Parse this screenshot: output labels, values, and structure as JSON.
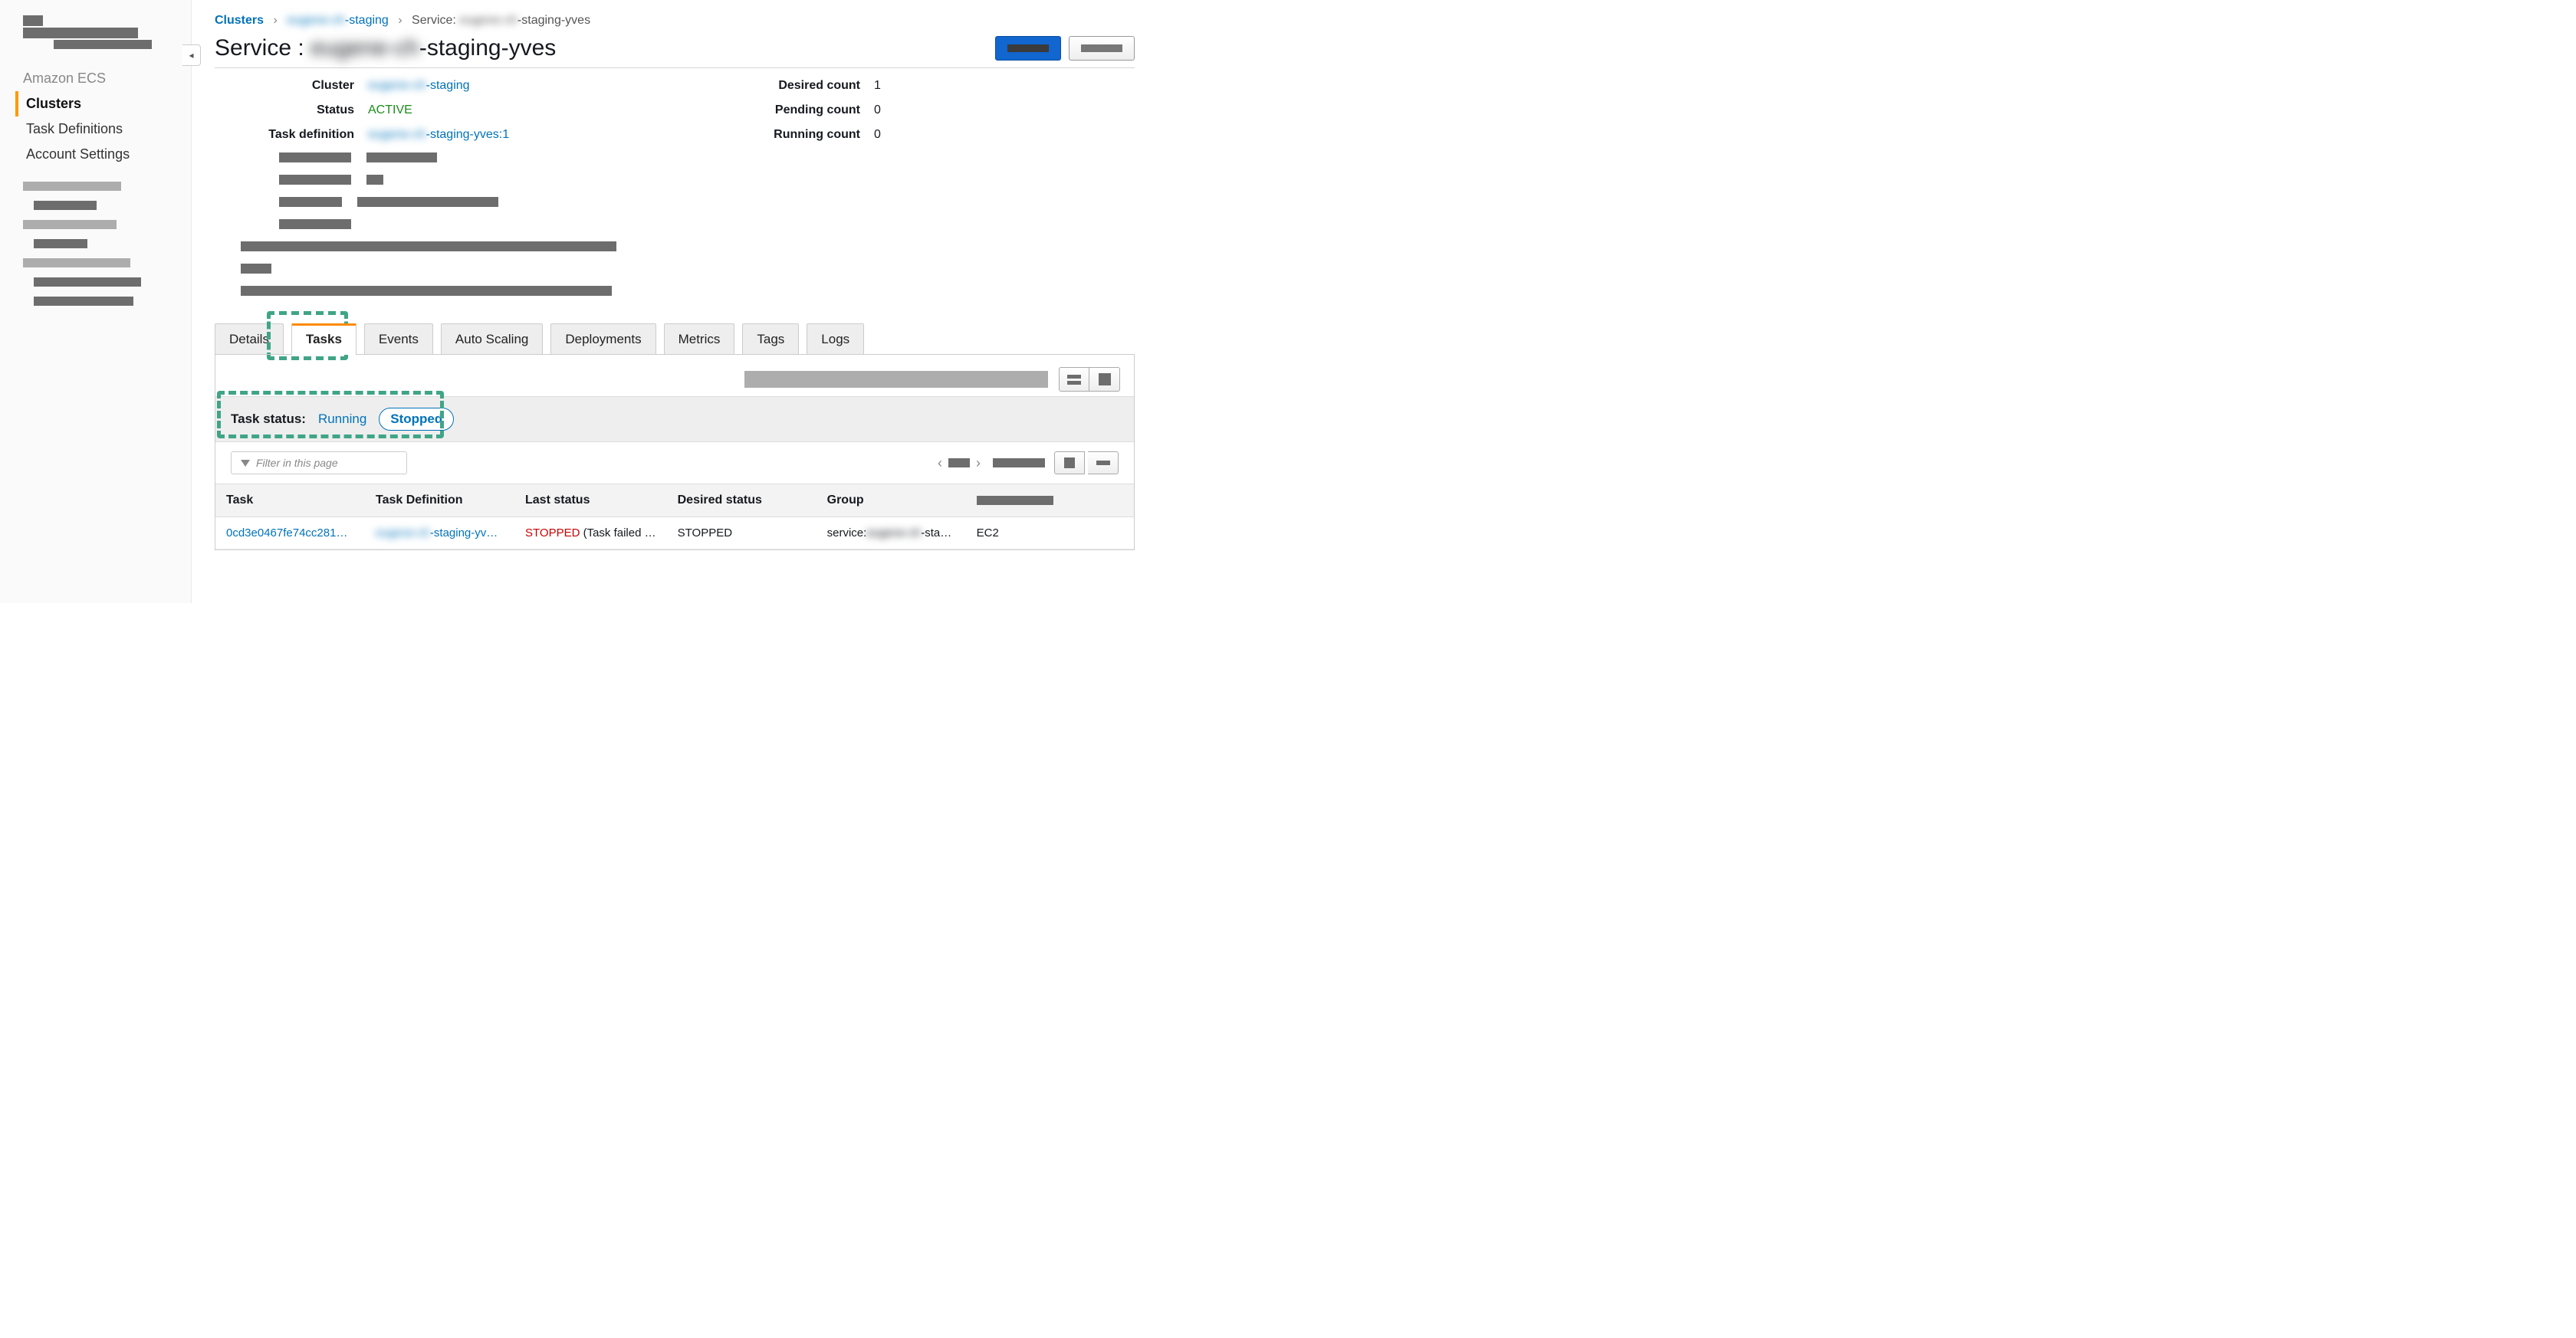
{
  "sidebar": {
    "service_title": "Amazon ECS",
    "nav": {
      "clusters": "Clusters",
      "task_definitions": "Task Definitions",
      "account_settings": "Account Settings"
    }
  },
  "breadcrumb": {
    "root": "Clusters",
    "cluster_redacted": "eugene-ch",
    "cluster_suffix": "-staging",
    "service_prefix": "Service: ",
    "service_redacted": "eugene-ch",
    "service_suffix": "-staging-yves"
  },
  "title": {
    "prefix": "Service : ",
    "redacted": "eugene-ch",
    "suffix": "-staging-yves"
  },
  "details": {
    "labels": {
      "cluster": "Cluster",
      "status": "Status",
      "task_definition": "Task definition",
      "desired_count": "Desired count",
      "pending_count": "Pending count",
      "running_count": "Running count"
    },
    "values": {
      "cluster_redacted": "eugene-ch",
      "cluster_suffix": "-staging",
      "status": "ACTIVE",
      "taskdef_redacted": "eugene-ch",
      "taskdef_suffix": "-staging-yves:1",
      "desired_count": "1",
      "pending_count": "0",
      "running_count": "0"
    }
  },
  "tabs": {
    "details": "Details",
    "tasks": "Tasks",
    "events": "Events",
    "auto_scaling": "Auto Scaling",
    "deployments": "Deployments",
    "metrics": "Metrics",
    "tags": "Tags",
    "logs": "Logs"
  },
  "task_status": {
    "label": "Task status:",
    "running": "Running",
    "stopped": "Stopped"
  },
  "filter": {
    "placeholder": "Filter in this page"
  },
  "table": {
    "headers": {
      "task": "Task",
      "task_definition": "Task Definition",
      "last_status": "Last status",
      "desired_status": "Desired status",
      "group": "Group"
    },
    "row": {
      "task_id": "0cd3e0467fe74cc281…",
      "taskdef_redacted": "eugene-ch",
      "taskdef_suffix": "-staging-yv…",
      "last_status_code": "STOPPED",
      "last_status_reason": " (Task failed …",
      "desired_status": "STOPPED",
      "group_prefix": "service:",
      "group_redacted": "eugene-ch",
      "group_suffix": "-sta…",
      "launch_type": "EC2"
    }
  }
}
